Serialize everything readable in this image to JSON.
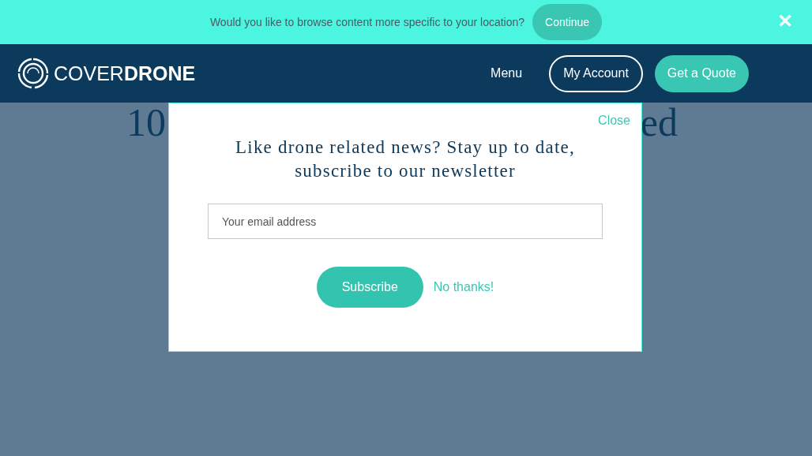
{
  "location_banner": {
    "message": "Would you like to browse content more specific to your location?",
    "continue_button": "Continue",
    "close_icon": "✕"
  },
  "navbar": {
    "logo": "COVER**DRONE**",
    "menu": "Menu",
    "account_button": "My Account",
    "quote_button": "Get a Quote"
  },
  "background_heading": {
    "left_fragment": "10",
    "right_fragment": "ed"
  },
  "newsletter_modal": {
    "close_link": "Close",
    "title": "Like drone related news? Stay up to date, subscribe to our newsletter",
    "email_field": {
      "placeholder": "Your email address"
    },
    "subscribe_button": "Subscribe",
    "decline_link": "No thanks!"
  }
}
